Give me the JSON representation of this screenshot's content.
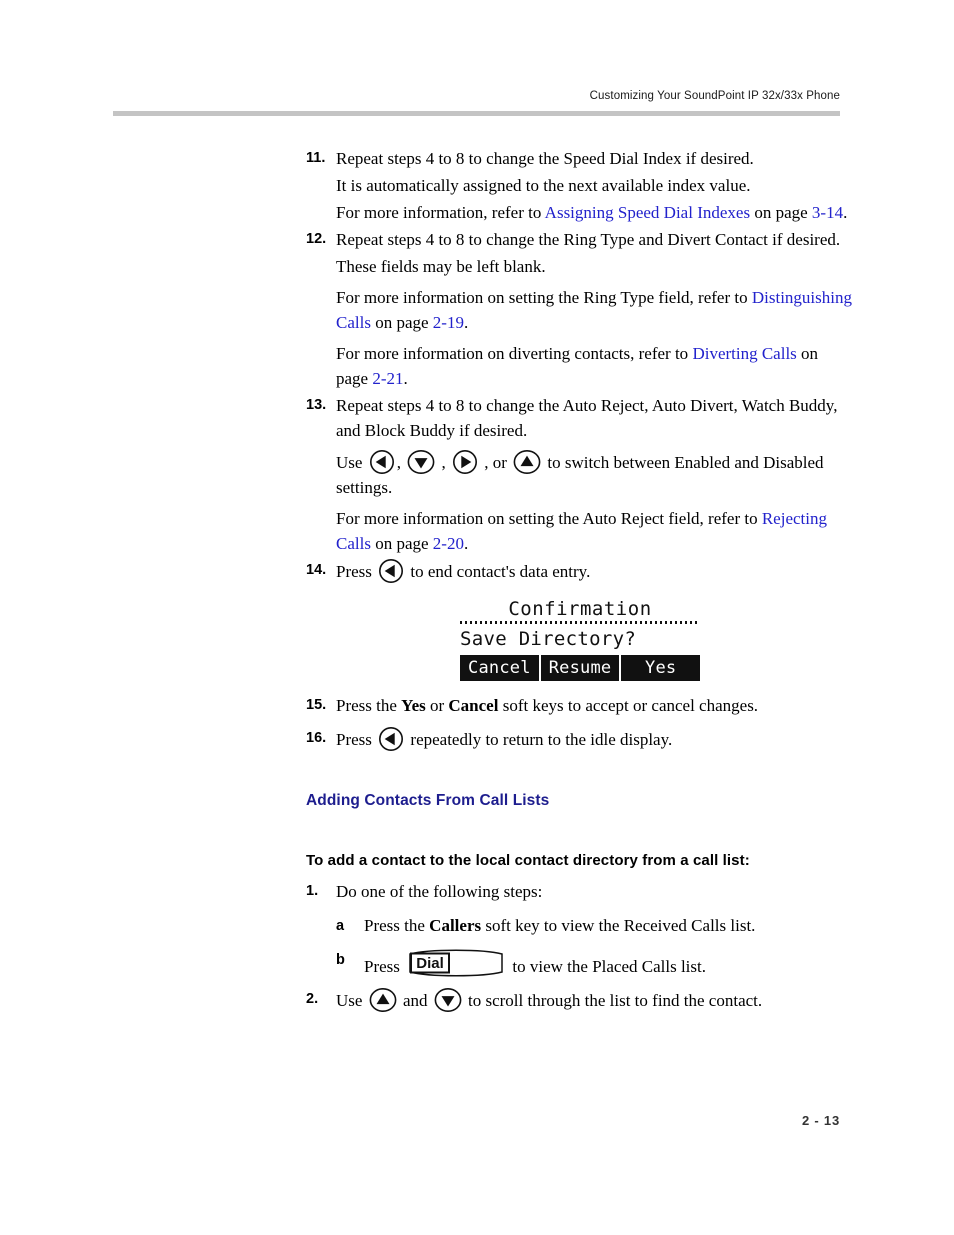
{
  "header": {
    "running_head": "Customizing Your SoundPoint IP 32x/33x Phone"
  },
  "colors": {
    "link": "#2222cc",
    "heading": "#1d1d8e",
    "rule": "#c4c4c4"
  },
  "steps": [
    {
      "number": "11.",
      "text": "Repeat steps 4 to 8 to change the Speed Dial Index if desired.",
      "paragraphs": [
        {
          "text": "It is automatically assigned to the next available index value."
        }
      ],
      "xref_line": {
        "lead": "For more information, refer to ",
        "link": "Assigning Speed Dial Indexes",
        "mid": " on page ",
        "page": "3-14",
        "tail": "."
      }
    },
    {
      "number": "12.",
      "text": "Repeat steps 4 to 8 to change the Ring Type and Divert Contact if desired.",
      "paragraphs": [
        {
          "text": "These fields may be left blank."
        }
      ],
      "xref_line_1": {
        "lead": "For more information on setting the Ring Type field, refer to ",
        "link": "Distinguishing Calls",
        "mid": " on page ",
        "page": "2-19",
        "tail": "."
      },
      "xref_line_2": {
        "lead": "For more information on diverting contacts, refer to ",
        "link": "Diverting Calls",
        "mid": " on page ",
        "page": "2-21",
        "tail": "."
      }
    },
    {
      "number": "13.",
      "text": "Repeat steps 4 to 8 to change the Auto Reject, Auto Divert, Watch Buddy, and Block Buddy if desired.",
      "use_line": {
        "lead": "Use ",
        "sep1": ", ",
        "sep2": " , ",
        "sep3": " , or ",
        "tail": " to switch between Enabled and Disabled settings.",
        "icons": [
          "arrow-left-key-icon",
          "arrow-down-key-icon",
          "arrow-right-key-icon",
          "arrow-up-key-icon"
        ]
      },
      "xref_line": {
        "lead": "For more information on setting the Auto Reject field, refer to ",
        "link": "Rejecting Calls",
        "mid": " on page ",
        "page": "2-20",
        "tail": "."
      }
    },
    {
      "number": "14.",
      "lead": "Press ",
      "icon": "arrow-left-key-icon",
      "tail": " to end contact's data entry."
    },
    {
      "number": "15.",
      "lead": "Press the ",
      "bold1": "Yes",
      "mid": " or ",
      "bold2": "Cancel",
      "tail": " soft keys to accept or cancel changes."
    },
    {
      "number": "16.",
      "lead": "Press ",
      "icon": "arrow-left-key-icon",
      "tail": " repeatedly to return to the idle display."
    }
  ],
  "lcd": {
    "title": "Confirmation",
    "prompt": "Save Directory?",
    "softkeys": [
      "Cancel",
      "Resume",
      "Yes"
    ]
  },
  "section": {
    "heading": "Adding Contacts From Call Lists",
    "sub_heading": "To add a contact to the local contact directory from a call list:",
    "steps": [
      {
        "number": "1.",
        "text": "Do one of the following steps:",
        "substeps": [
          {
            "letter": "a",
            "lead": "Press the ",
            "bold": "Callers",
            "tail": " soft key to view the Received Calls list."
          },
          {
            "letter": "b",
            "lead": "Press ",
            "key_label": "Dial",
            "tail": " to view the Placed Calls list."
          }
        ]
      },
      {
        "number": "2.",
        "lead": "Use ",
        "icon1": "arrow-up-key-icon",
        "mid": " and ",
        "icon2": "arrow-down-key-icon",
        "tail": " to scroll through the list to find the contact."
      }
    ]
  },
  "footer": {
    "page_number": "2 - 13"
  }
}
